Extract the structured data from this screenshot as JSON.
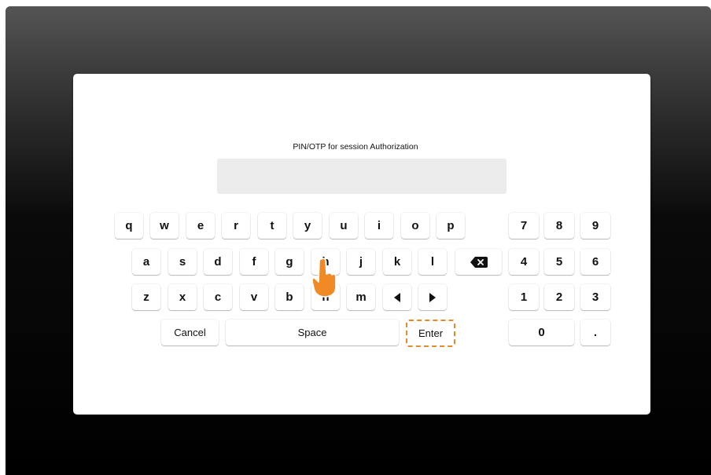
{
  "dialog": {
    "title": "PIN/OTP for session Authorization",
    "pin_value": "",
    "pin_placeholder": ""
  },
  "keyboard": {
    "row1": [
      "q",
      "w",
      "e",
      "r",
      "t",
      "y",
      "u",
      "i",
      "o",
      "p"
    ],
    "row2": [
      "a",
      "s",
      "d",
      "f",
      "g",
      "h",
      "j",
      "k",
      "l"
    ],
    "row3": [
      "z",
      "x",
      "c",
      "v",
      "b",
      "n",
      "m"
    ],
    "arrow_left_icon": "left-arrow-icon",
    "arrow_right_icon": "right-arrow-icon",
    "backspace_icon": "backspace-icon",
    "cancel_label": "Cancel",
    "space_label": "Space",
    "enter_label": "Enter"
  },
  "numpad": {
    "row1": [
      "7",
      "8",
      "9"
    ],
    "row2": [
      "4",
      "5",
      "6"
    ],
    "row3": [
      "1",
      "2",
      "3"
    ],
    "zero": "0",
    "dot": "."
  },
  "pointer": {
    "icon": "pointing-hand-icon",
    "color": "#f08a24"
  },
  "colors": {
    "highlight": "#e8892e",
    "input_bg": "#ececec"
  }
}
